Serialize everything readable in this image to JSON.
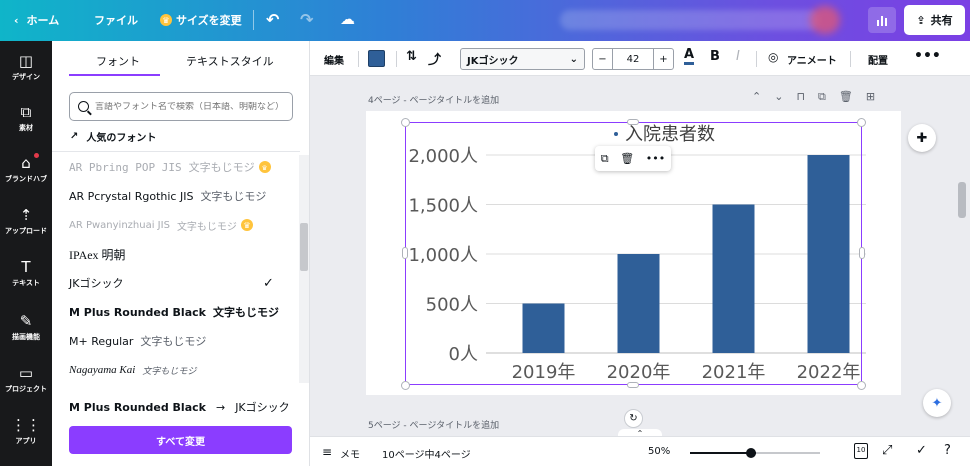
{
  "topbar": {
    "home": "ホーム",
    "file": "ファイル",
    "resize": "サイズを変更",
    "share": "共有"
  },
  "rail": [
    {
      "label": "デザイン",
      "icon": "layout-icon"
    },
    {
      "label": "素材",
      "icon": "elements-icon"
    },
    {
      "label": "ブランドハブ",
      "icon": "brand-icon"
    },
    {
      "label": "アップロード",
      "icon": "upload-icon"
    },
    {
      "label": "テキスト",
      "icon": "text-icon"
    },
    {
      "label": "描画機能",
      "icon": "draw-icon"
    },
    {
      "label": "プロジェクト",
      "icon": "folder-icon"
    },
    {
      "label": "アプリ",
      "icon": "apps-icon"
    }
  ],
  "panel": {
    "tab_font": "フォント",
    "tab_textstyle": "テキストスタイル",
    "search_placeholder": "言語やフォント名で検索（日本語、明朝など）",
    "popular": "人気のフォント",
    "fonts": [
      {
        "name": "AR Pbring POP JIS",
        "sample": "文字もじモジ",
        "faded": true,
        "crown": true
      },
      {
        "name": "AR Pcrystal Rgothic JIS",
        "sample": "文字もじモジ",
        "faded": false,
        "crown": false
      },
      {
        "name": "AR Pwanyinzhuai JIS",
        "sample": "文字もじモジ",
        "faded": true,
        "crown": true
      },
      {
        "name": "IPAex 明朝",
        "sample": "",
        "faded": false,
        "crown": false
      },
      {
        "name": "JKゴシック",
        "sample": "",
        "faded": false,
        "crown": false,
        "checked": true
      },
      {
        "name": "M Plus Rounded Black",
        "sample": "文字もじモジ",
        "faded": false,
        "crown": false,
        "bold": true
      },
      {
        "name": "M+ Regular",
        "sample": "文字もじモジ",
        "faded": false,
        "crown": false
      },
      {
        "name": "Nagayama Kai",
        "sample": "文字もじモジ",
        "faded": false,
        "crown": false
      }
    ],
    "replace_from": "M Plus Rounded Black",
    "replace_to": "JKゴシック",
    "replace_all": "すべて変更"
  },
  "toolbar": {
    "edit": "編集",
    "font": "JKゴシック",
    "size": "42",
    "animate": "アニメート",
    "position": "配置",
    "text_color": "#2f5f98"
  },
  "canvas": {
    "page_label": "4ページ - ページタイトルを追加",
    "next_page_label": "5ページ - ページタイトルを追加"
  },
  "chart_data": {
    "type": "bar",
    "title": "入院患者数",
    "categories": [
      "2019年",
      "2020年",
      "2021年",
      "2022年"
    ],
    "values": [
      500,
      1000,
      1500,
      2000
    ],
    "yticks": [
      "0人",
      "500人",
      "1,000人",
      "1,500人",
      "2,000人"
    ],
    "ylim": [
      0,
      2000
    ],
    "bar_color": "#2f5f98",
    "grid": true
  },
  "bottombar": {
    "notes": "メモ",
    "page_count": "10ページ中4ページ",
    "zoom": "50%",
    "page_badge": "10"
  }
}
